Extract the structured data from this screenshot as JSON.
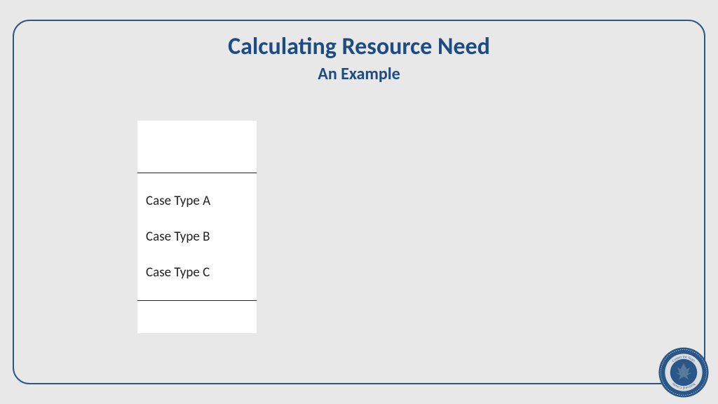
{
  "header": {
    "title": "Calculating Resource Need",
    "subtitle": "An Example"
  },
  "table": {
    "rows": [
      "Case Type A",
      "Case Type B",
      "Case Type C"
    ]
  },
  "seal": {
    "outer_text": "National Center for State Courts",
    "colors": {
      "primary": "#2a5788",
      "accent": "#6d6d6d"
    }
  }
}
